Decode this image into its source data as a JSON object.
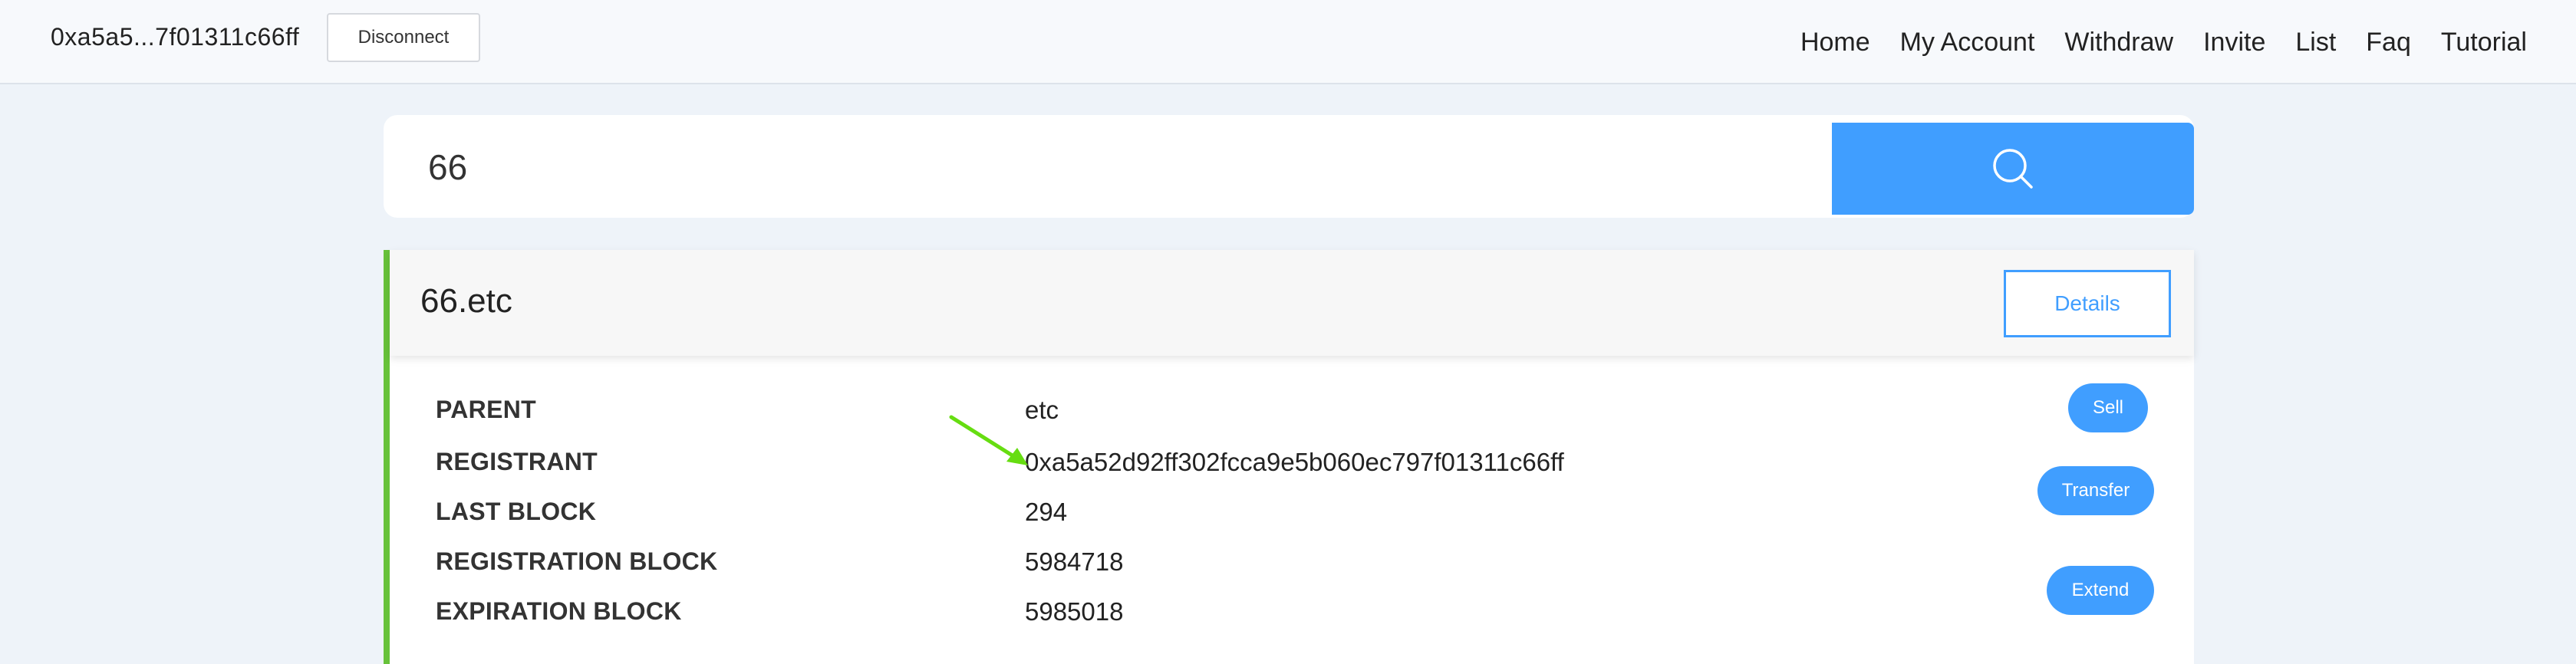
{
  "header": {
    "wallet_address": "0xa5a5...7f01311c66ff",
    "disconnect_label": "Disconnect",
    "nav": [
      "Home",
      "My Account",
      "Withdraw",
      "Invite",
      "List",
      "Faq",
      "Tutorial"
    ]
  },
  "search": {
    "value": "66",
    "button_icon": "search-icon"
  },
  "result": {
    "name": "66.etc",
    "details_label": "Details",
    "rows": [
      {
        "label": "PARENT",
        "value": "etc"
      },
      {
        "label": "REGISTRANT",
        "value": "0xa5a52d92ff302fcca9e5b060ec797f01311c66ff"
      },
      {
        "label": "LAST BLOCK",
        "value": "294"
      },
      {
        "label": "REGISTRATION BLOCK",
        "value": "5984718"
      },
      {
        "label": "EXPIRATION BLOCK",
        "value": "5985018"
      }
    ],
    "actions": {
      "sell_label": "Sell",
      "transfer_label": "Transfer",
      "extend_label": "Extend"
    }
  },
  "colors": {
    "accent": "#409eff",
    "card_border": "#67c23a",
    "annotation_arrow": "#66dd11",
    "background": "#eef3f9"
  }
}
